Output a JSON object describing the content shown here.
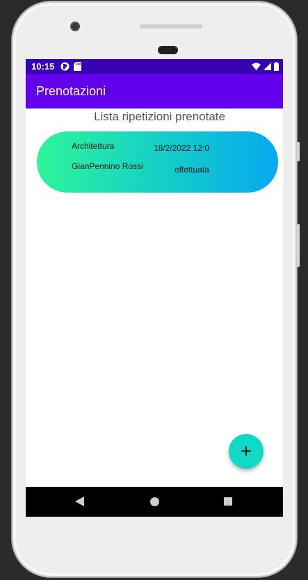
{
  "status_bar": {
    "time": "10:15",
    "icons": [
      "app-notification-icon",
      "sd-card-icon",
      "wifi-icon",
      "signal-icon",
      "battery-icon"
    ]
  },
  "app_bar": {
    "title": "Prenotazioni",
    "color": "#6200ee",
    "status_color": "#3700b3"
  },
  "list": {
    "title": "Lista ripetizioni prenotate",
    "items": [
      {
        "subject": "Architettura",
        "date": "18/2/2022 12:0",
        "teacher": "GianPennino Rossi",
        "status": "effettuata"
      }
    ]
  },
  "fab": {
    "label": "+",
    "icon": "plus-icon",
    "color": "#10d9c6"
  },
  "nav_bar": {
    "icons": [
      "back-icon",
      "home-icon",
      "recent-apps-icon"
    ]
  }
}
